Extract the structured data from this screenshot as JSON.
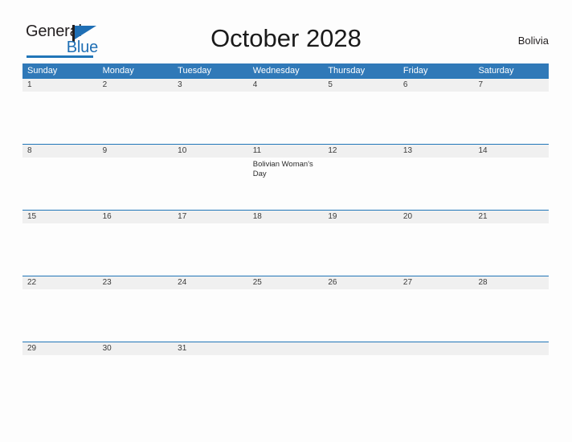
{
  "brand": {
    "name_top": "General",
    "name_bottom": "Blue",
    "flag_icon": "flag-triangle-icon",
    "accent_color": "#2176b8",
    "text_color": "#231f20"
  },
  "header": {
    "title": "October 2028",
    "region": "Bolivia"
  },
  "calendar": {
    "header_color": "#3079b8",
    "date_band_color": "#f0f0f0",
    "weekdays": [
      "Sunday",
      "Monday",
      "Tuesday",
      "Wednesday",
      "Thursday",
      "Friday",
      "Saturday"
    ],
    "weeks": [
      {
        "days": [
          {
            "num": "1",
            "event": ""
          },
          {
            "num": "2",
            "event": ""
          },
          {
            "num": "3",
            "event": ""
          },
          {
            "num": "4",
            "event": ""
          },
          {
            "num": "5",
            "event": ""
          },
          {
            "num": "6",
            "event": ""
          },
          {
            "num": "7",
            "event": ""
          }
        ]
      },
      {
        "days": [
          {
            "num": "8",
            "event": ""
          },
          {
            "num": "9",
            "event": ""
          },
          {
            "num": "10",
            "event": ""
          },
          {
            "num": "11",
            "event": "Bolivian Woman's Day"
          },
          {
            "num": "12",
            "event": ""
          },
          {
            "num": "13",
            "event": ""
          },
          {
            "num": "14",
            "event": ""
          }
        ]
      },
      {
        "days": [
          {
            "num": "15",
            "event": ""
          },
          {
            "num": "16",
            "event": ""
          },
          {
            "num": "17",
            "event": ""
          },
          {
            "num": "18",
            "event": ""
          },
          {
            "num": "19",
            "event": ""
          },
          {
            "num": "20",
            "event": ""
          },
          {
            "num": "21",
            "event": ""
          }
        ]
      },
      {
        "days": [
          {
            "num": "22",
            "event": ""
          },
          {
            "num": "23",
            "event": ""
          },
          {
            "num": "24",
            "event": ""
          },
          {
            "num": "25",
            "event": ""
          },
          {
            "num": "26",
            "event": ""
          },
          {
            "num": "27",
            "event": ""
          },
          {
            "num": "28",
            "event": ""
          }
        ]
      },
      {
        "days": [
          {
            "num": "29",
            "event": ""
          },
          {
            "num": "30",
            "event": ""
          },
          {
            "num": "31",
            "event": ""
          },
          {
            "num": "",
            "event": ""
          },
          {
            "num": "",
            "event": ""
          },
          {
            "num": "",
            "event": ""
          },
          {
            "num": "",
            "event": ""
          }
        ]
      }
    ]
  }
}
